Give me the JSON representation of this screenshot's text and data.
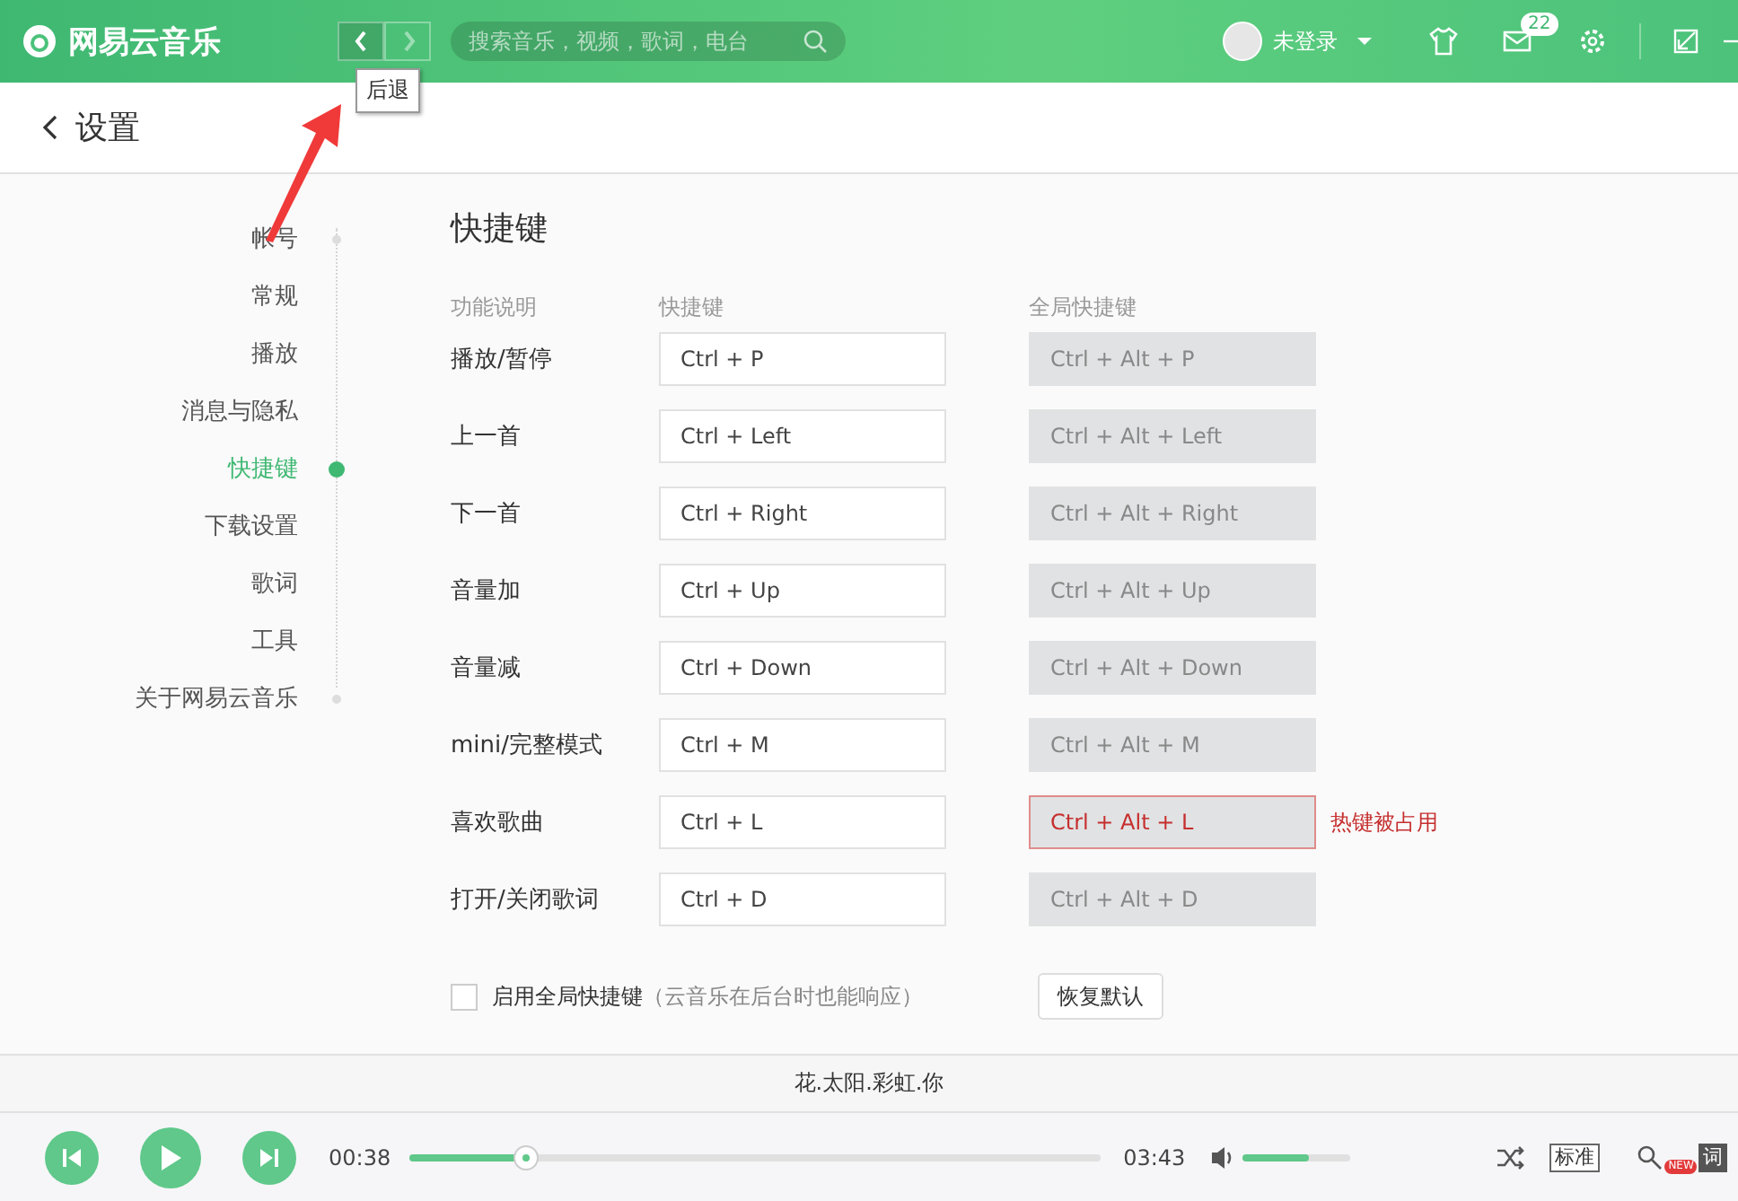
{
  "header": {
    "app_name": "网易云音乐",
    "nav": [
      {
        "kind": "back",
        "disabled": false
      },
      {
        "kind": "forward",
        "disabled": true
      }
    ],
    "tooltip": "后退",
    "search": {
      "placeholder": "搜索音乐，视频，歌词，电台"
    },
    "user": "未登录",
    "mail_badge": "22"
  },
  "page_title": "设置",
  "sidebar": {
    "items": [
      {
        "label": "帐号",
        "selected": false
      },
      {
        "label": "常规",
        "selected": false
      },
      {
        "label": "播放",
        "selected": false
      },
      {
        "label": "消息与隐私",
        "selected": false
      },
      {
        "label": "快捷键",
        "selected": true
      },
      {
        "label": "下载设置",
        "selected": false
      },
      {
        "label": "歌词",
        "selected": false
      },
      {
        "label": "工具",
        "selected": false
      },
      {
        "label": "关于网易云音乐",
        "selected": false
      }
    ]
  },
  "shortcuts": {
    "title": "快捷键",
    "columns": [
      "功能说明",
      "快捷键",
      "全局快捷键"
    ],
    "rows": [
      {
        "label": "播放/暂停",
        "hotkey": "Ctrl + P",
        "global": "Ctrl + Alt + P",
        "conflict": false
      },
      {
        "label": "上一首",
        "hotkey": "Ctrl + Left",
        "global": "Ctrl + Alt + Left",
        "conflict": false
      },
      {
        "label": "下一首",
        "hotkey": "Ctrl + Right",
        "global": "Ctrl + Alt + Right",
        "conflict": false
      },
      {
        "label": "音量加",
        "hotkey": "Ctrl + Up",
        "global": "Ctrl + Alt + Up",
        "conflict": false
      },
      {
        "label": "音量减",
        "hotkey": "Ctrl + Down",
        "global": "Ctrl + Alt + Down",
        "conflict": false
      },
      {
        "label": "mini/完整模式",
        "hotkey": "Ctrl + M",
        "global": "Ctrl + Alt + M",
        "conflict": false
      },
      {
        "label": "喜欢歌曲",
        "hotkey": "Ctrl + L",
        "global": "Ctrl + Alt + L",
        "conflict": true,
        "warning": "热键被占用"
      },
      {
        "label": "打开/关闭歌词",
        "hotkey": "Ctrl + D",
        "global": "Ctrl + Alt + D",
        "conflict": false
      }
    ],
    "global_toggle": {
      "label": "启用全局快捷键",
      "note": "（云音乐在后台时也能响应）",
      "checked": false
    },
    "reset_button": "恢复默认"
  },
  "player": {
    "song": "花.太阳.彩虹.你",
    "elapsed": "00:38",
    "total": "03:43",
    "progress": {
      "level": 0.17
    },
    "volume": {
      "level": 0.62
    },
    "quality": "标准",
    "new_badge": "NEW",
    "lyrics": "词"
  }
}
